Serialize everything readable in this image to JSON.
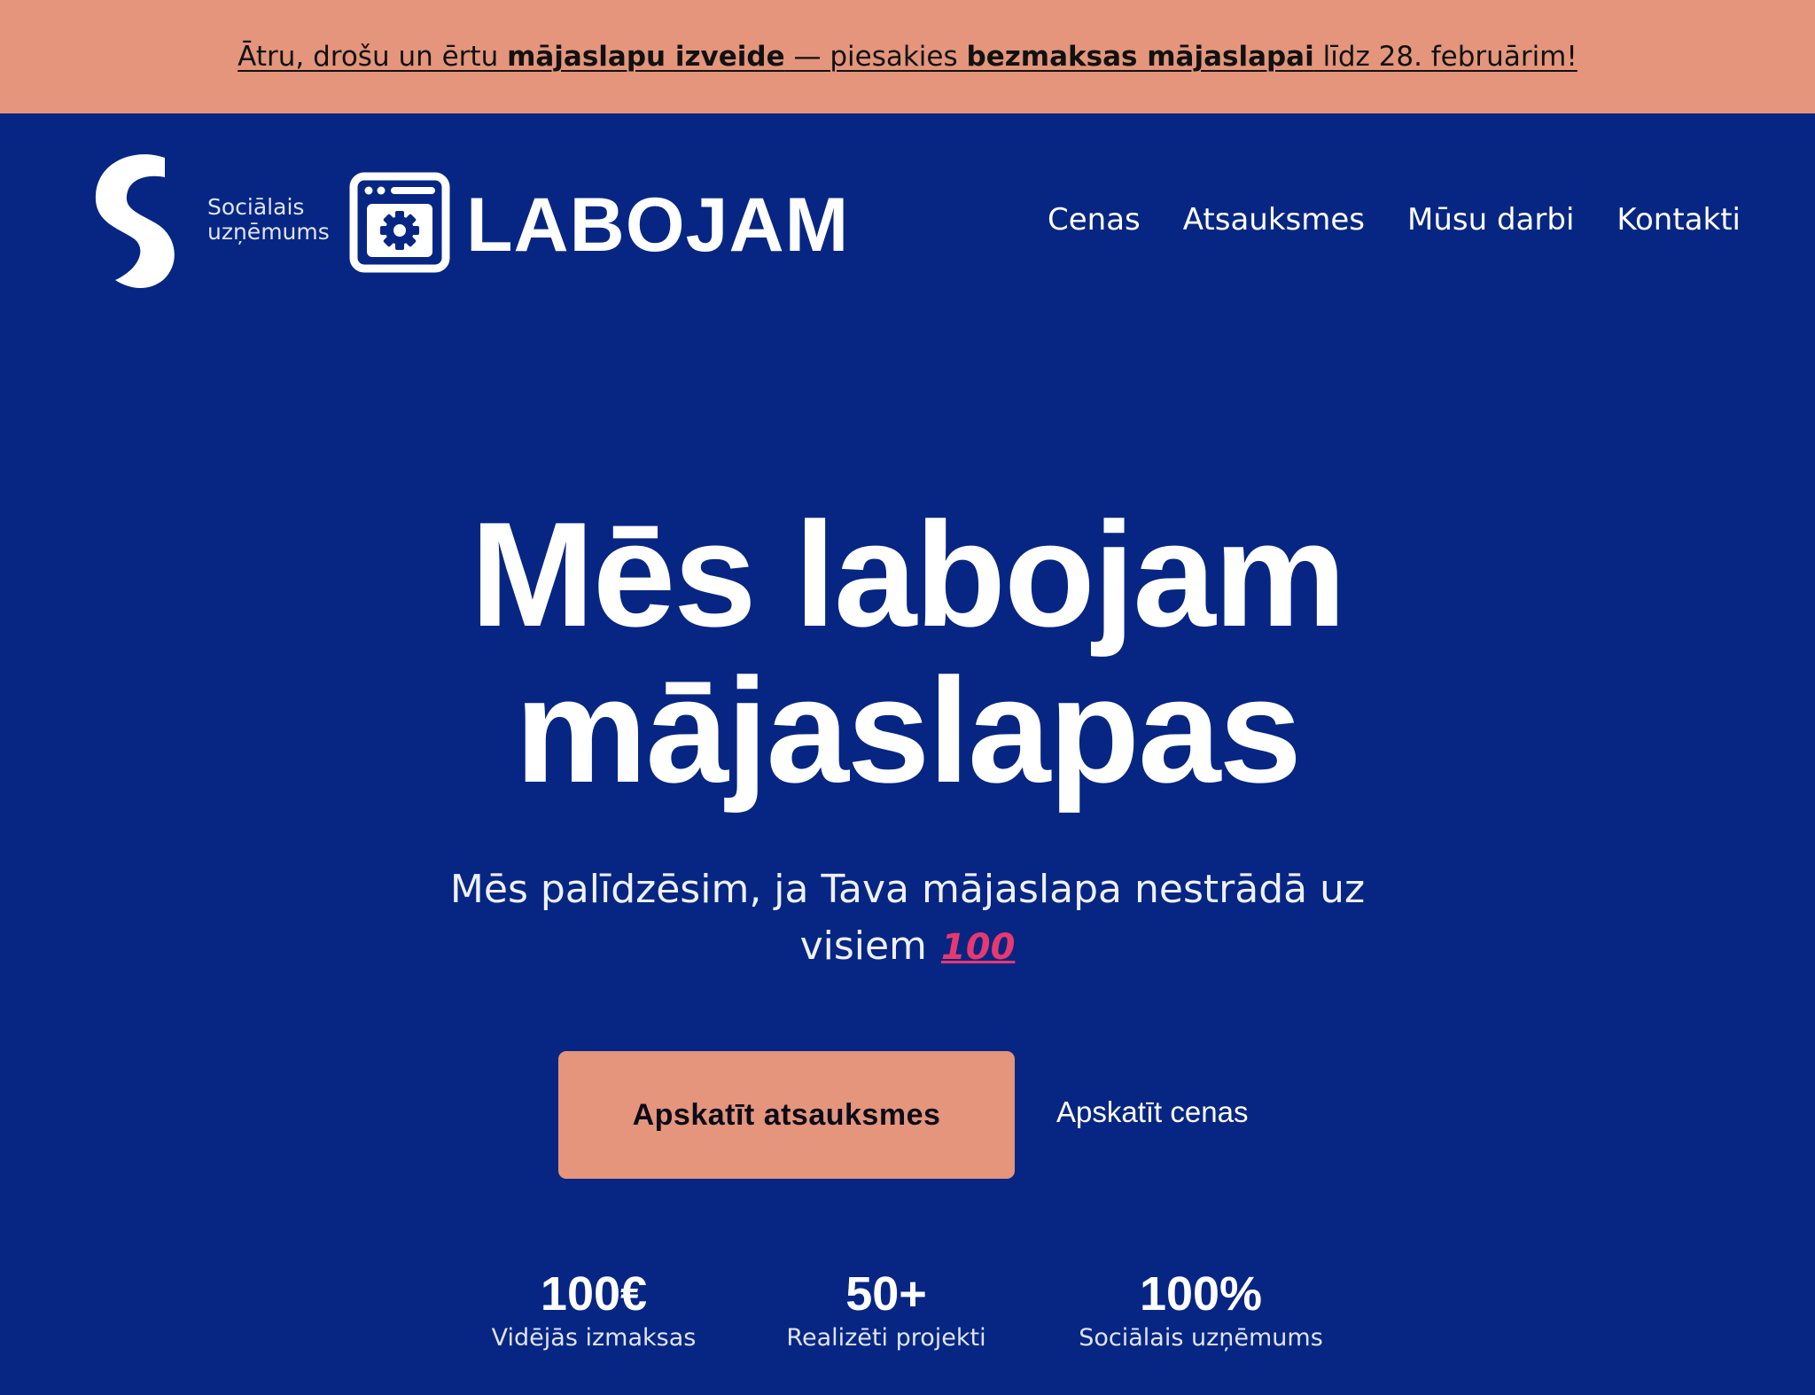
{
  "announcement": {
    "part1": "Ātru, drošu un ērtu ",
    "bold1": "mājaslapu izveide",
    "part2": " — piesakies ",
    "bold2": "bezmaksas mājaslapai",
    "part3": " līdz 28. februārim!"
  },
  "header": {
    "social_enterprise_line1": "Sociālais",
    "social_enterprise_line2": "uzņēmums",
    "brand": "LABOJAM",
    "nav": [
      "Cenas",
      "Atsauksmes",
      "Mūsu darbi",
      "Kontakti"
    ]
  },
  "hero": {
    "title_line1": "Mēs labojam",
    "title_line2": "mājaslapas",
    "subtitle_line1": "Mēs palīdzēsim, ja Tava mājaslapa nestrādā uz",
    "subtitle_line2": "visiem",
    "emoji": "100",
    "primary_button": "Apskatīt atsauksmes",
    "secondary_link": "Apskatīt cenas"
  },
  "stats": [
    {
      "value": "100€",
      "label": "Vidējās izmaksas"
    },
    {
      "value": "50+",
      "label": "Realizēti projekti"
    },
    {
      "value": "100%",
      "label": "Sociālais uzņēmums"
    }
  ],
  "colors": {
    "background": "#072684",
    "accent": "#e4957b",
    "emoji": "#e8386f"
  }
}
